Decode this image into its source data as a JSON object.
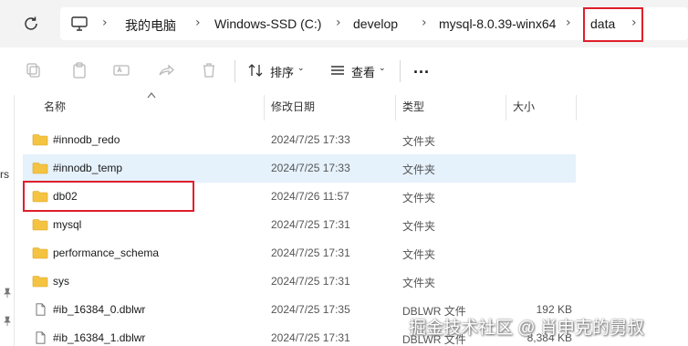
{
  "breadcrumb": {
    "items": [
      "我的电脑",
      "Windows-SSD (C:)",
      "develop",
      "mysql-8.0.39-winx64",
      "data"
    ]
  },
  "toolbar": {
    "sort_label": "排序",
    "view_label": "查看",
    "more_label": "..."
  },
  "nav": {
    "partial_text": "rs"
  },
  "columns": {
    "name": "名称",
    "modified": "修改日期",
    "type": "类型",
    "size": "大小"
  },
  "files": [
    {
      "name": "#innodb_redo",
      "modified": "2024/7/25 17:33",
      "type": "文件夹",
      "size": "",
      "kind": "folder"
    },
    {
      "name": "#innodb_temp",
      "modified": "2024/7/25 17:33",
      "type": "文件夹",
      "size": "",
      "kind": "folder"
    },
    {
      "name": "db02",
      "modified": "2024/7/26 11:57",
      "type": "文件夹",
      "size": "",
      "kind": "folder"
    },
    {
      "name": "mysql",
      "modified": "2024/7/25 17:31",
      "type": "文件夹",
      "size": "",
      "kind": "folder"
    },
    {
      "name": "performance_schema",
      "modified": "2024/7/25 17:31",
      "type": "文件夹",
      "size": "",
      "kind": "folder"
    },
    {
      "name": "sys",
      "modified": "2024/7/25 17:31",
      "type": "文件夹",
      "size": "",
      "kind": "folder"
    },
    {
      "name": "#ib_16384_0.dblwr",
      "modified": "2024/7/25 17:35",
      "type": "DBLWR 文件",
      "size": "192 KB",
      "kind": "file"
    },
    {
      "name": "#ib_16384_1.dblwr",
      "modified": "2024/7/25 17:31",
      "type": "DBLWR 文件",
      "size": "8,384 KB",
      "kind": "file"
    }
  ],
  "watermark": "掘金技术社区 @ 肖申克的舅叔",
  "colors": {
    "highlight": "#e01e2b",
    "selected_row": "#e5f1fb",
    "folder": "#f5c342"
  }
}
